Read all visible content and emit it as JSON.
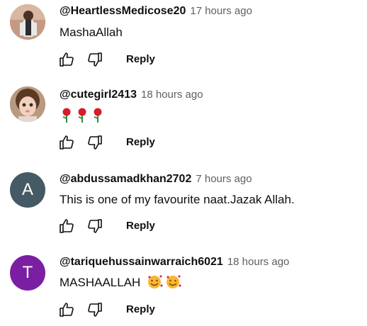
{
  "comments": [
    {
      "author": "@HeartlessMedicose20",
      "time": "17 hours ago",
      "text": "MashaAllah",
      "reply_label": "Reply",
      "avatar": {
        "type": "photo",
        "bg": "#cfa58f"
      }
    },
    {
      "author": "@cutegirl2413",
      "time": "18 hours ago",
      "text": "",
      "emojis": [
        "rose",
        "rose",
        "rose"
      ],
      "reply_label": "Reply",
      "avatar": {
        "type": "photo",
        "bg": "#8a6b4a"
      }
    },
    {
      "author": "@abdussamadkhan2702",
      "time": "7 hours ago",
      "text": "This is one of my favourite naat.Jazak Allah.",
      "reply_label": "Reply",
      "avatar": {
        "type": "letter",
        "letter": "A",
        "bg": "#455a64"
      }
    },
    {
      "author": "@tariquehussainwarraich6021",
      "time": "18 hours ago",
      "text": "MASHAALLAH",
      "emojis": [
        "smiling-face-with-hearts",
        "smiling-face-with-hearts"
      ],
      "reply_label": "Reply",
      "avatar": {
        "type": "letter",
        "letter": "T",
        "bg": "#7b1fa2"
      }
    }
  ],
  "icons": {
    "like": "thumb-up-icon",
    "dislike": "thumb-down-icon"
  }
}
